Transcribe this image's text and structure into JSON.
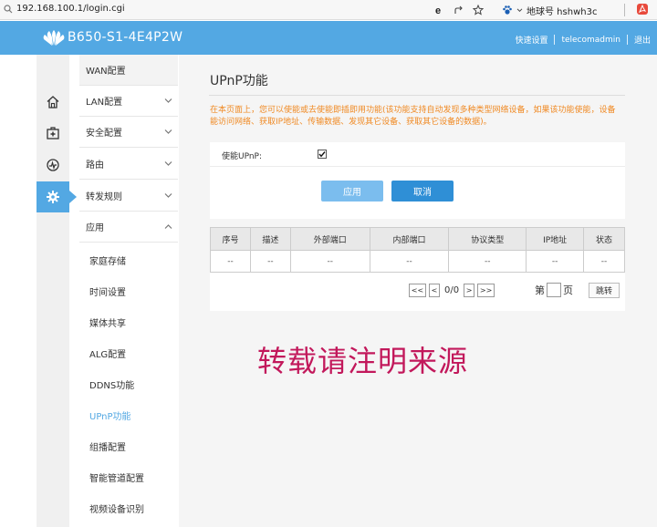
{
  "browser": {
    "url": "192.168.100.1/login.cgi",
    "extension_label": "地球号 hshwh3c"
  },
  "header": {
    "model": "B650-S1-4E4P2W",
    "quick_setup": "快速设置",
    "user": "telecomadmin",
    "logout": "退出",
    "bg_color": "#53a8e3"
  },
  "nav_icons": [
    {
      "icon": "home-icon",
      "active": false
    },
    {
      "icon": "medical-kit-icon",
      "active": false
    },
    {
      "icon": "speedometer-icon",
      "active": false
    },
    {
      "icon": "gear-icon",
      "active": true
    }
  ],
  "menu": {
    "items": [
      {
        "label": "WAN配置",
        "chevron": "none"
      },
      {
        "label": "LAN配置",
        "chevron": "down"
      },
      {
        "label": "安全配置",
        "chevron": "down"
      },
      {
        "label": "路由",
        "chevron": "down"
      },
      {
        "label": "转发规则",
        "chevron": "down"
      },
      {
        "label": "应用",
        "chevron": "up"
      }
    ],
    "sub_items": [
      {
        "label": "家庭存储",
        "active": false
      },
      {
        "label": "时间设置",
        "active": false
      },
      {
        "label": "媒体共享",
        "active": false
      },
      {
        "label": "ALG配置",
        "active": false
      },
      {
        "label": "DDNS功能",
        "active": false
      },
      {
        "label": "UPnP功能",
        "active": true
      },
      {
        "label": "组播配置",
        "active": false
      },
      {
        "label": "智能管道配置",
        "active": false
      },
      {
        "label": "视频设备识别",
        "active": false
      }
    ]
  },
  "main": {
    "title": "UPnP功能",
    "notice": "在本页面上，您可以使能或去使能即插即用功能(该功能支持自动发现多种类型网络设备，如果该功能使能，设备能访问网络、获取IP地址、传输数据、发现其它设备、获取其它设备的数据)。",
    "enable_label": "使能UPnP:",
    "enable_checked": true,
    "apply_label": "应用",
    "cancel_label": "取消",
    "table": {
      "headers": [
        "序号",
        "描述",
        "外部端口",
        "内部端口",
        "协议类型",
        "IP地址",
        "状态"
      ],
      "rows": [
        [
          "--",
          "--",
          "--",
          "--",
          "--",
          "--",
          "--"
        ]
      ]
    },
    "pager": {
      "first": "<<",
      "prev": "<",
      "count": "0/0",
      "next": ">",
      "last": ">>",
      "page_prefix": "第",
      "page_suffix": "页",
      "jump": "跳转"
    }
  },
  "watermark": "转载请注明来源"
}
